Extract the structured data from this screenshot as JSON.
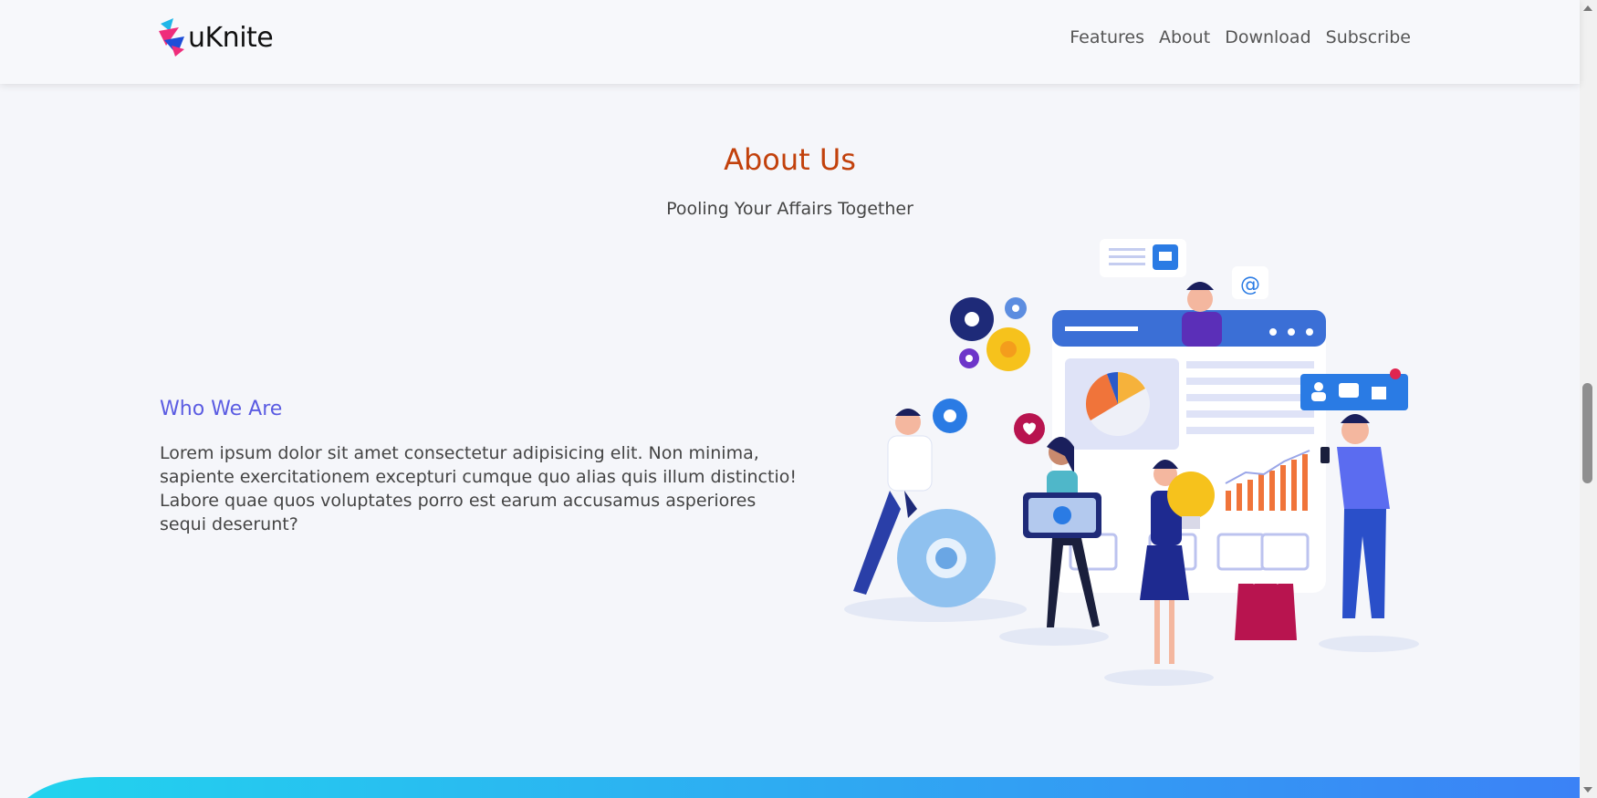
{
  "brand": {
    "name": "uKnite",
    "logo_icon": "uknite-logo-icon"
  },
  "nav": {
    "items": [
      "Features",
      "About",
      "Download",
      "Subscribe"
    ]
  },
  "about": {
    "title": "About Us",
    "subtitle": "Pooling Your Affairs Together",
    "who_heading": "Who We Are",
    "paragraph": "Lorem ipsum dolor sit amet consectetur adipisicing elit. Non minima, sapiente exercitationem excepturi cumque quo alias quis illum distinctio! Labore quae quos voluptates porro est earum accusamus asperiores sequi deserunt?"
  },
  "illustration": {
    "icon": "team-collaboration-illustration"
  },
  "colors": {
    "accent_title": "#c2410c",
    "accent_heading": "#5b5ce2",
    "wave_start": "#22d3ee",
    "wave_end": "#3b82f6"
  }
}
